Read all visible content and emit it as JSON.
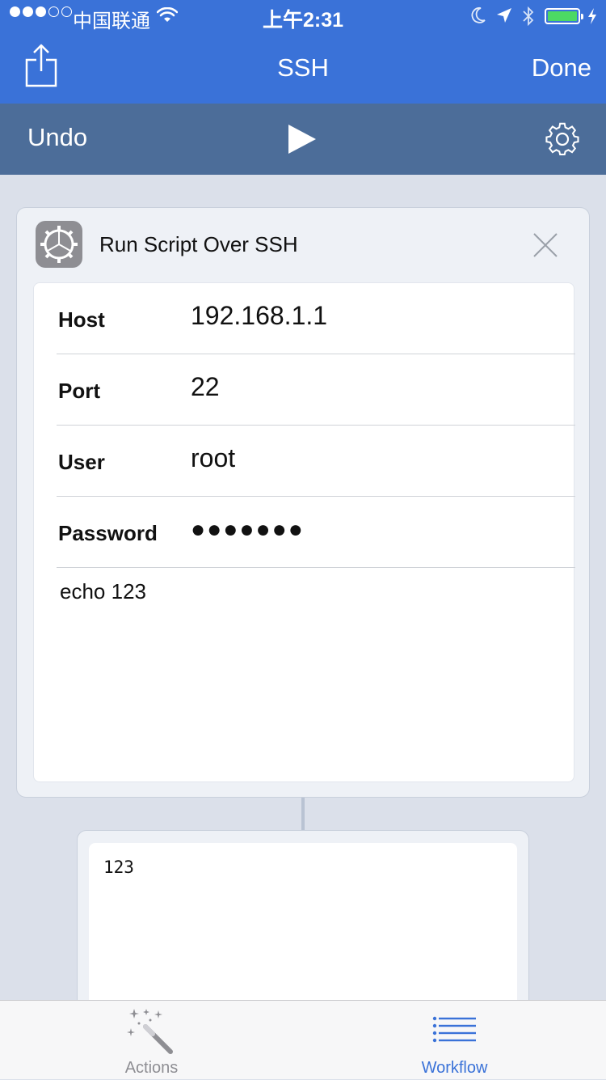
{
  "status_bar": {
    "carrier": "中国联通",
    "time": "上午2:31",
    "signal_bars_filled": 3,
    "signal_bars_total": 5,
    "battery_level": 1.0,
    "battery_color": "#4cd964"
  },
  "nav": {
    "title": "SSH",
    "done_label": "Done",
    "share_icon": "share-icon",
    "background": "#3a72d8"
  },
  "toolbar": {
    "undo_label": "Undo",
    "play_icon": "play-icon",
    "settings_icon": "gear-icon",
    "background": "#4c6d99"
  },
  "action": {
    "title": "Run Script Over SSH",
    "icon": "gear-icon",
    "close_icon": "close-icon",
    "fields": [
      {
        "label": "Host",
        "value": "192.168.1.1"
      },
      {
        "label": "Port",
        "value": "22"
      },
      {
        "label": "User",
        "value": "root"
      },
      {
        "label": "Password",
        "value": "●●●●●●●"
      }
    ],
    "script": "echo 123"
  },
  "output": {
    "text": "123"
  },
  "tabs": [
    {
      "label": "Actions",
      "icon": "magic-wand-icon",
      "active": false
    },
    {
      "label": "Workflow",
      "icon": "list-icon",
      "active": true
    }
  ]
}
